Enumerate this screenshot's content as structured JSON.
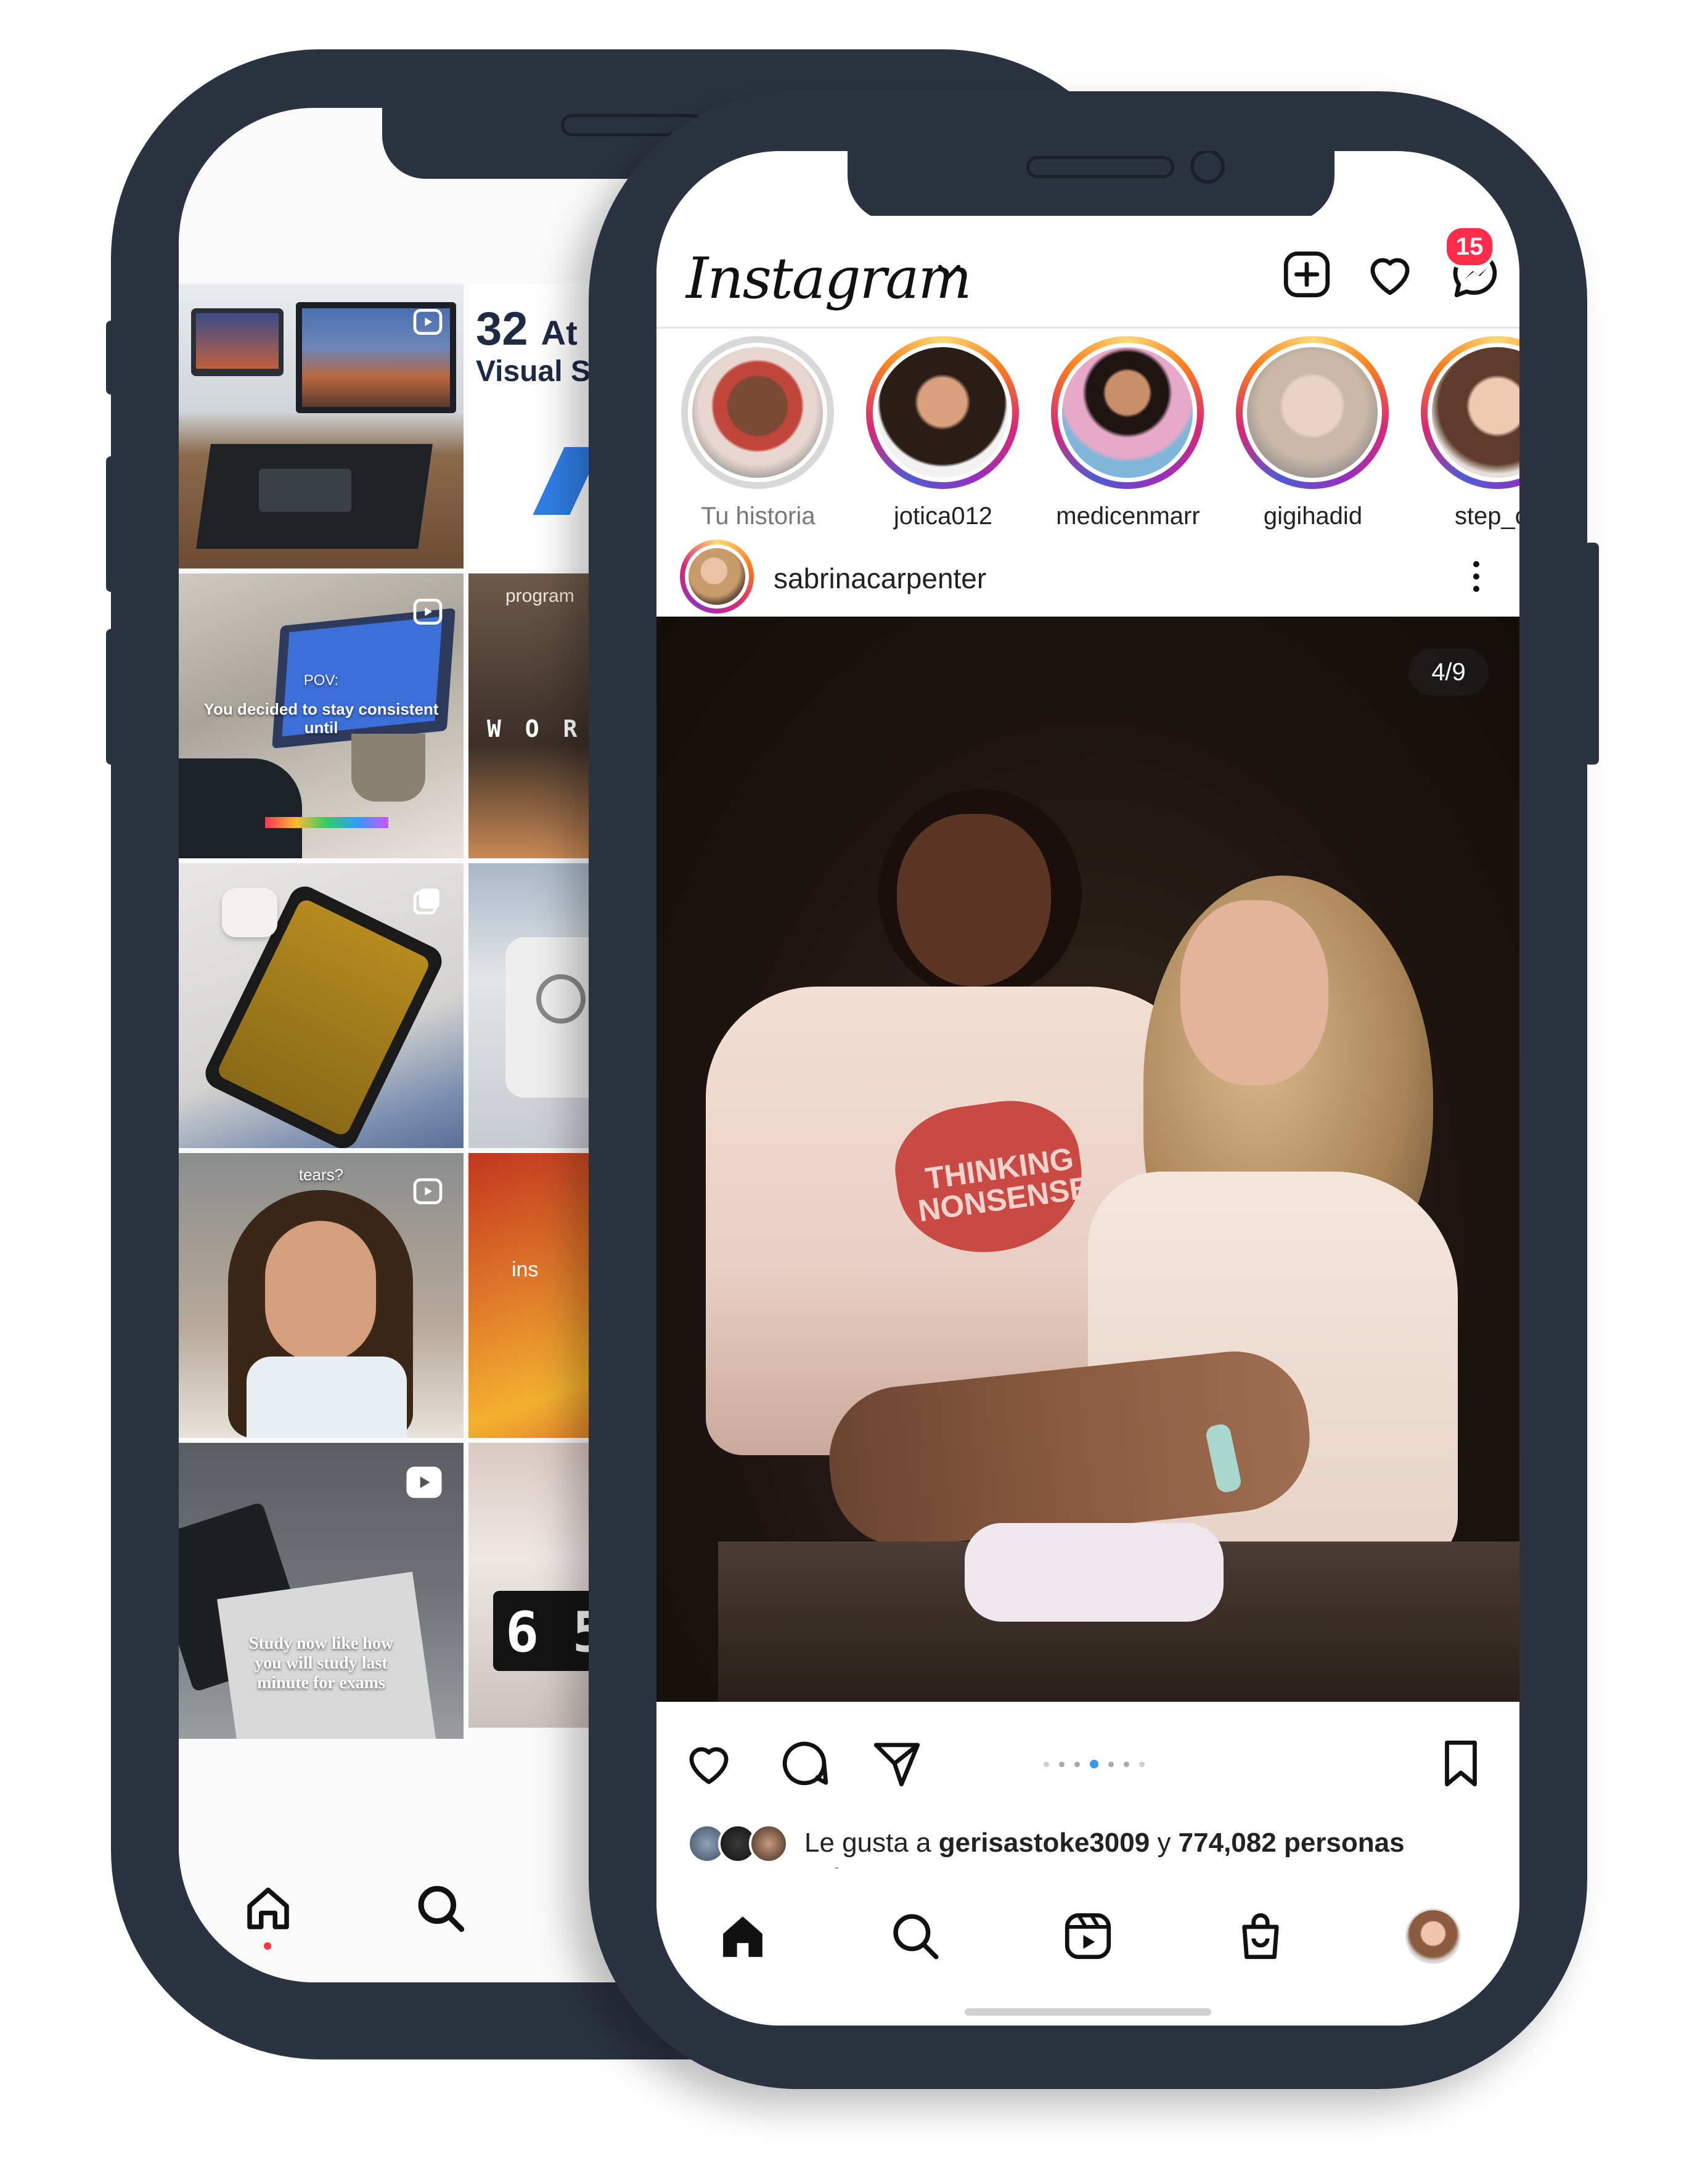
{
  "back_phone": {
    "promo_tile": {
      "headline_num": "32",
      "headline_rest": "At",
      "subline": "Visual S"
    },
    "tiles": [
      {
        "id": "desk-setup",
        "overlay": ""
      },
      {
        "id": "promo",
        "overlay": ""
      },
      {
        "id": "pov-laptop",
        "overlay_1": "POV:",
        "overlay_2": "You decided to stay consistent",
        "overlay_3": "until"
      },
      {
        "id": "program-work",
        "overlay_1": "program",
        "overlay_2": "W O R K"
      },
      {
        "id": "tablet-bed",
        "overlay": ""
      },
      {
        "id": "bag",
        "overlay": ""
      },
      {
        "id": "tears-selfie",
        "overlay": "tears?"
      },
      {
        "id": "fruit",
        "overlay": "ins"
      },
      {
        "id": "study-notebook",
        "overlay_1": "Study now like how",
        "overlay_2": "you will study last",
        "overlay_3": "minute for exams"
      },
      {
        "id": "clock",
        "overlay": "6 5"
      }
    ]
  },
  "front_phone": {
    "app_title": "Instagram",
    "messages_badge": "15",
    "stories": [
      {
        "name": "Tu historia",
        "own": true
      },
      {
        "name": "jotica012",
        "own": false
      },
      {
        "name": "medicenmarr",
        "own": false
      },
      {
        "name": "gigihadid",
        "own": false
      },
      {
        "name": "step_ca",
        "own": false
      }
    ],
    "post": {
      "username": "sabrinacarpenter",
      "counter": "4/9",
      "shirt_text_1": "THINKING",
      "shirt_text_2": "NONSENSE",
      "likes_prefix": "Le gusta a",
      "likes_user": "gerisastoke3009",
      "likes_join": "y",
      "likes_count": "774,082 personas",
      "likes_more": "más"
    },
    "colors": {
      "accent_blue": "#3897f0",
      "badge_red": "#ff2b4b",
      "frame": "#2b3240"
    }
  }
}
